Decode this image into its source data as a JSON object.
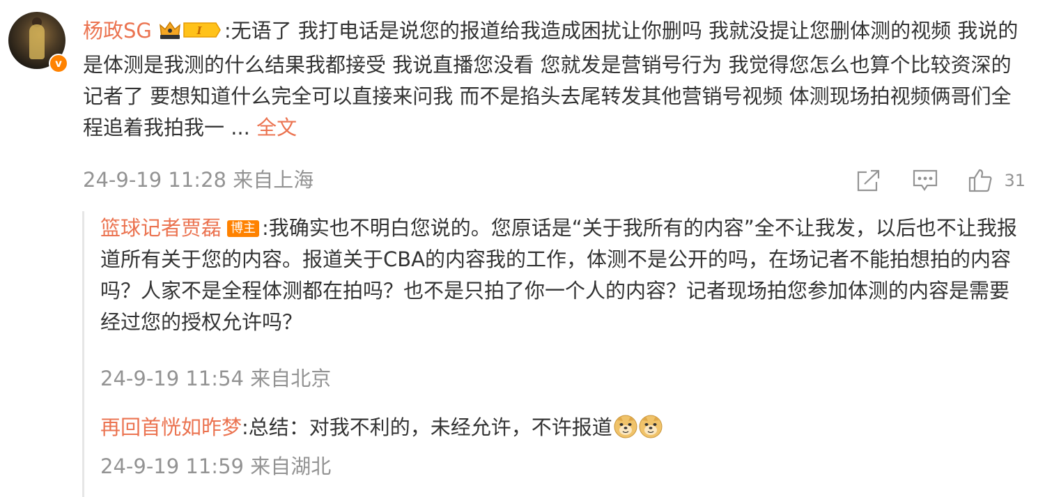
{
  "comment": {
    "username": "杨政SG",
    "verified_badge": "v",
    "text": ":无语了 我打电话是说您的报道给我造成困扰让你删吗 我就没提让您删体测的视频 我说的是体测是我测的什么结果我都接受 我说直播您没看 您就发是营销号行为 我觉得您怎么也算个比较资深的记者了 要想知道什么完全可以直接来问我 而不是掐头去尾转发其他营销号视频 体测现场拍视频俩哥们全程追着我拍我一 ... ",
    "full_text_link": "全文",
    "timestamp": "24-9-19 11:28 来自上海",
    "like_count": "31",
    "icons": {
      "share": "share-icon",
      "reply": "comment-icon",
      "like": "thumbs-up-icon",
      "crown": "crown-level-icon"
    },
    "level_badge": "I"
  },
  "replies": [
    {
      "username": "篮球记者贾磊",
      "badge": "博主",
      "text": ":我确实也不明白您说的。您原话是“关于我所有的内容”全不让我发，以后也不让我报道所有关于您的内容。报道关于CBA的内容我的工作，体测不是公开的吗，在场记者不能拍想拍的内容吗？人家不是全程体测都在拍吗？也不是只拍了你一个人的内容？记者现场拍您参加体测的内容是需要经过您的授权允许吗？",
      "timestamp": "24-9-19 11:54 来自北京"
    },
    {
      "username": "再回首恍如昨梦",
      "text": ":总结：对我不利的，未经允许，不许报道",
      "emoji_count": 2,
      "emoji": "doge-emoji",
      "timestamp": "24-9-19 11:59 来自湖北"
    }
  ],
  "colors": {
    "accent": "#eb7350",
    "meta": "#939393",
    "text": "#333333",
    "badge_orange": "#ff8200"
  }
}
